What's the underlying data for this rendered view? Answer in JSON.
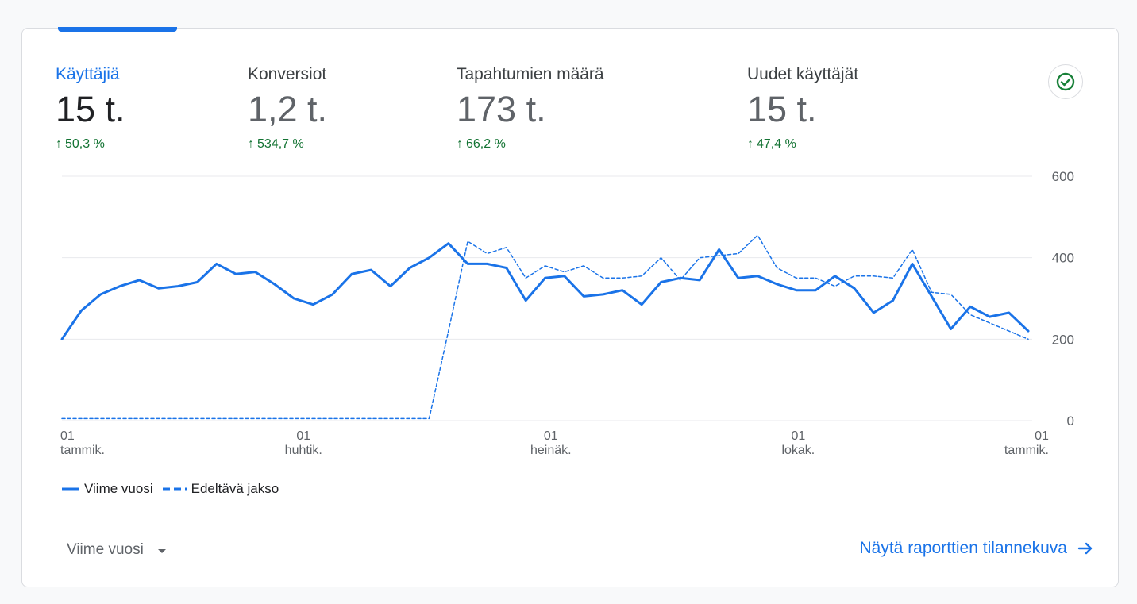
{
  "metrics": [
    {
      "label": "Käyttäjiä",
      "value": "15 t.",
      "change": "50,3 %"
    },
    {
      "label": "Konversiot",
      "value": "1,2 t.",
      "change": "534,7 %"
    },
    {
      "label": "Tapahtumien määrä",
      "value": "173 t.",
      "change": "66,2 %"
    },
    {
      "label": "Uudet käyttäjät",
      "value": "15 t.",
      "change": "47,4 %"
    }
  ],
  "status_icon": "check-circle-icon",
  "colors": {
    "accent": "#1a73e8",
    "positive": "#137333",
    "status": "#188038"
  },
  "legend": {
    "current": "Viime vuosi",
    "previous": "Edeltävä jakso"
  },
  "period_selector": {
    "value": "Viime vuosi"
  },
  "report_link": {
    "label": "Näytä raporttien tilannekuva"
  },
  "chart_data": {
    "type": "line",
    "y_ticks": [
      "600",
      "400",
      "200",
      "0"
    ],
    "ylim": [
      0,
      600
    ],
    "x_ticks": [
      {
        "day": "01",
        "month": "tammik.",
        "index": 0
      },
      {
        "day": "01",
        "month": "huhtik.",
        "index": 12.5
      },
      {
        "day": "01",
        "month": "heinäk.",
        "index": 25.3
      },
      {
        "day": "01",
        "month": "lokak.",
        "index": 38.1
      },
      {
        "day": "01",
        "month": "tammik.",
        "index": 50.9
      }
    ],
    "x_count": 51,
    "series": [
      {
        "name": "Viime vuosi",
        "style": "solid",
        "values": [
          200,
          270,
          310,
          330,
          345,
          325,
          330,
          340,
          385,
          360,
          365,
          335,
          300,
          285,
          310,
          360,
          370,
          330,
          375,
          400,
          435,
          385,
          385,
          375,
          295,
          350,
          355,
          305,
          310,
          320,
          285,
          340,
          350,
          345,
          420,
          350,
          355,
          335,
          320,
          320,
          355,
          325,
          265,
          295,
          385,
          305,
          225,
          280,
          255,
          265,
          220
        ]
      },
      {
        "name": "Edeltävä jakso",
        "style": "dashed",
        "values": [
          5,
          5,
          5,
          5,
          5,
          5,
          5,
          5,
          5,
          5,
          5,
          5,
          5,
          5,
          5,
          5,
          5,
          5,
          5,
          5,
          220,
          440,
          410,
          425,
          350,
          380,
          365,
          380,
          350,
          350,
          355,
          400,
          345,
          400,
          405,
          410,
          455,
          375,
          350,
          350,
          330,
          355,
          355,
          350,
          420,
          315,
          310,
          260,
          240,
          220,
          200
        ]
      }
    ],
    "grid": true,
    "legend_position": "bottom-left"
  }
}
